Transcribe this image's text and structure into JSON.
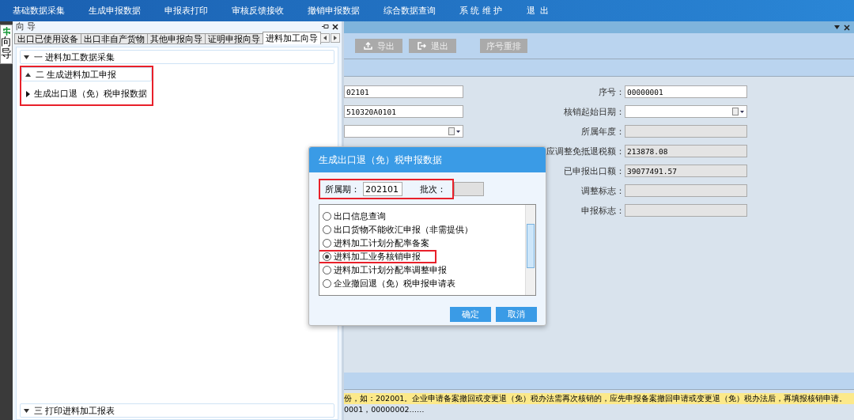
{
  "menu": [
    "基础数据采集",
    "生成申报数据",
    "申报表打印",
    "审核反馈接收",
    "撤销申报数据",
    "综合数据查询",
    "系 统 维 护",
    "退  出"
  ],
  "side_tab": {
    "label": "向导"
  },
  "guide_panel": {
    "title": "向 导",
    "tabs": [
      {
        "label": "出口已使用设备",
        "selected": false
      },
      {
        "label": "出口非自产货物",
        "selected": false
      },
      {
        "label": "其他申报向导",
        "selected": false
      },
      {
        "label": "证明申报向导",
        "selected": false
      },
      {
        "label": "进料加工向导",
        "selected": true
      }
    ],
    "sections": [
      {
        "label": "一  进料加工数据采集",
        "expanded": false,
        "highlighted": false
      },
      {
        "label": "二  生成进料加工申报",
        "expanded": true,
        "highlighted": true,
        "children": [
          {
            "label": "生成出口退（免）税申报数据"
          }
        ]
      },
      {
        "label": "三  打印进料加工报表",
        "expanded": false,
        "highlighted": false
      }
    ]
  },
  "toolbar": [
    {
      "label": "导出",
      "kind": "export"
    },
    {
      "label": "退出",
      "kind": "exit"
    },
    {
      "label": "序号重排",
      "kind": "plain"
    }
  ],
  "left_fields": [
    {
      "kind": "text",
      "value": "02101"
    },
    {
      "kind": "text",
      "value": "510320A0101"
    },
    {
      "kind": "date"
    }
  ],
  "right_fields": [
    {
      "label": "序号：",
      "kind": "text",
      "value": "00000001"
    },
    {
      "label": "核销起始日期：",
      "kind": "date"
    },
    {
      "label": "所属年度：",
      "kind": "readonly"
    },
    {
      "label": "应调整免抵退税额：",
      "kind": "readonly",
      "value": "213878.08"
    },
    {
      "label": "已申报出口额：",
      "kind": "readonly",
      "value": "39077491.57"
    },
    {
      "label": "调整标志：",
      "kind": "readonly"
    },
    {
      "label": "申报标志：",
      "kind": "readonly"
    }
  ],
  "hint": {
    "line_1": "份，如：202001。企业申请备案撤回或变更退（免）税办法需再次核销的，应先申报备案撤回申请或变更退（免）税办法后，再填报核销申请。",
    "line_2": "0001，00000002……"
  },
  "dialog": {
    "title": "生成出口退（免）税申报数据",
    "period_label": "所属期：",
    "period_value": "202101",
    "batch_label": "批次：",
    "period_highlighted": true,
    "options": [
      {
        "label": "出口信息查询",
        "selected": false,
        "highlighted": false
      },
      {
        "label": "出口货物不能收汇申报（非需提供）",
        "selected": false,
        "highlighted": false
      },
      {
        "label": "进料加工计划分配率备案",
        "selected": false,
        "highlighted": false
      },
      {
        "label": "进料加工业务核销申报",
        "selected": true,
        "highlighted": true
      },
      {
        "label": "进料加工计划分配率调整申报",
        "selected": false,
        "highlighted": false
      },
      {
        "label": "企业撤回退（免）税申报申请表",
        "selected": false,
        "highlighted": false
      }
    ],
    "buttons": [
      "确定",
      "取消"
    ]
  }
}
